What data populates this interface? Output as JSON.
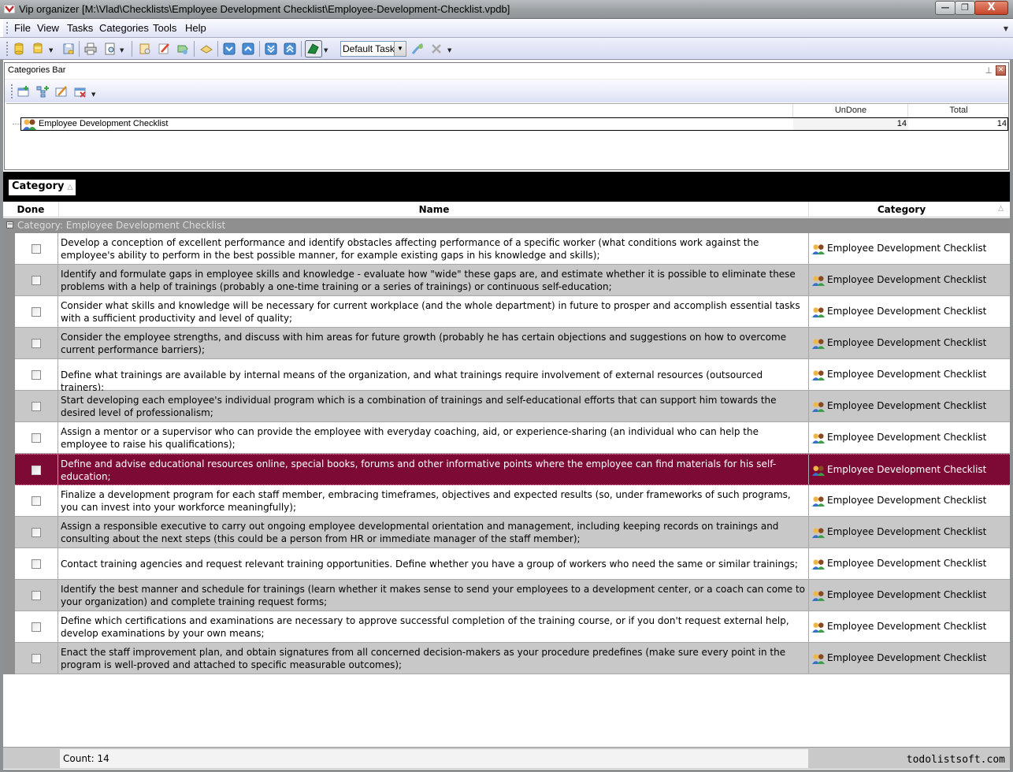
{
  "window": {
    "title": "Vip organizer [M:\\Vlad\\Checklists\\Employee Development Checklist\\Employee-Development-Checklist.vpdb]",
    "minimize_glyph": "—",
    "restore_glyph": "❐",
    "close_glyph": "X"
  },
  "menu": {
    "items": [
      "File",
      "View",
      "Tasks",
      "Categories",
      "Tools",
      "Help"
    ],
    "overflow_glyph": "▼"
  },
  "toolbar": {
    "buttons": [
      "open-database-icon",
      "new-database-icon",
      "save-icon",
      "print-icon",
      "print-preview-icon",
      "new-task-icon",
      "edit-task-icon",
      "task-properties-icon",
      "mark-done-icon",
      "move-down-icon",
      "move-up-icon",
      "move-bottom-icon",
      "move-top-icon",
      "filter-icon",
      "apply-view-icon",
      "delete-view-icon"
    ],
    "view_select_value": "Default Task",
    "dropdown_glyph": "▼"
  },
  "categories_bar": {
    "title": "Categories Bar",
    "pin_glyph": "⊥",
    "close_glyph": "✕",
    "columns": {
      "undone": "UnDone",
      "total": "Total"
    },
    "rows": [
      {
        "name": "Employee Development Checklist",
        "undone": "14",
        "total": "14"
      }
    ]
  },
  "group_by": {
    "chip_label": "Category",
    "sort_glyph": "△"
  },
  "grid": {
    "columns": {
      "done": "Done",
      "name": "Name",
      "category": "Category"
    },
    "sort_glyph": "△",
    "group_label": "Category: Employee Development Checklist",
    "group_toggle": "−",
    "selected_index": 7,
    "colors": {
      "selected_bg": "#7d0a35",
      "alt_row_bg": "#c8c8c8",
      "group_bg": "#8f8f8f"
    },
    "tasks": [
      {
        "done": false,
        "category": "Employee Development Checklist",
        "name": "Develop a conception of excellent performance and identify obstacles affecting performance of a specific worker (what conditions work against the employee's ability to perform in the best possible manner, for example existing gaps in his knowledge and skills);"
      },
      {
        "done": false,
        "category": "Employee Development Checklist",
        "name": "Identify and formulate gaps in employee skills and knowledge - evaluate how \"wide\" these gaps are, and estimate whether it is possible to eliminate these problems with a help of trainings (probably a one-time training or a series of trainings) or continuous self-education;"
      },
      {
        "done": false,
        "category": "Employee Development Checklist",
        "name": "Consider what skills and knowledge will be necessary for current workplace (and the whole department) in future to prosper and accomplish essential tasks with a sufficient productivity and level of quality;"
      },
      {
        "done": false,
        "category": "Employee Development Checklist",
        "name": "Consider the employee strengths, and discuss with him areas for future growth (probably he has certain objections and suggestions on how to overcome current performance barriers);"
      },
      {
        "done": false,
        "category": "Employee Development Checklist",
        "name": "Define what trainings are available by internal means of the organization, and what trainings require involvement of external resources (outsourced trainers);"
      },
      {
        "done": false,
        "category": "Employee Development Checklist",
        "name": "Start developing each employee's individual program which is a combination of trainings and self-educational efforts that can support him towards the desired level of professionalism;"
      },
      {
        "done": false,
        "category": "Employee Development Checklist",
        "name": "Assign a mentor or a supervisor who can provide the employee with everyday coaching, aid, or experience-sharing (an individual who can help the employee to raise his qualifications);"
      },
      {
        "done": false,
        "category": "Employee Development Checklist",
        "name": "Define and advise educational resources online, special books, forums and other informative points where the employee can find materials for his self-education;"
      },
      {
        "done": false,
        "category": "Employee Development Checklist",
        "name": "Finalize a development program for each staff member, embracing timeframes, objectives and expected results (so, under frameworks of such programs, you can invest into your workforce meaningfully);"
      },
      {
        "done": false,
        "category": "Employee Development Checklist",
        "name": "Assign a responsible executive to carry out ongoing employee developmental orientation and management, including keeping records on trainings and consulting about the next steps (this could be a person from HR or immediate manager of the staff member);"
      },
      {
        "done": false,
        "category": "Employee Development Checklist",
        "name": "Contact training agencies and request relevant training opportunities. Define whether you have a group of workers who need the same or similar trainings;"
      },
      {
        "done": false,
        "category": "Employee Development Checklist",
        "name": "Identify the best manner and schedule for trainings (learn whether it makes sense to send your employees to a development center, or a coach can come to your organization) and complete training request forms;"
      },
      {
        "done": false,
        "category": "Employee Development Checklist",
        "name": "Define which certifications and examinations are necessary to approve successful completion of the training course, or if you don't request external help, develop examinations by your own means;"
      },
      {
        "done": false,
        "category": "Employee Development Checklist",
        "name": "Enact the staff improvement plan, and obtain signatures from all concerned decision-makers as your procedure predefines (make sure every point in the program is well-proved and attached to specific measurable outcomes);"
      }
    ]
  },
  "footer": {
    "count_label": "Count: 14",
    "brand": "todolistsoft.com"
  }
}
